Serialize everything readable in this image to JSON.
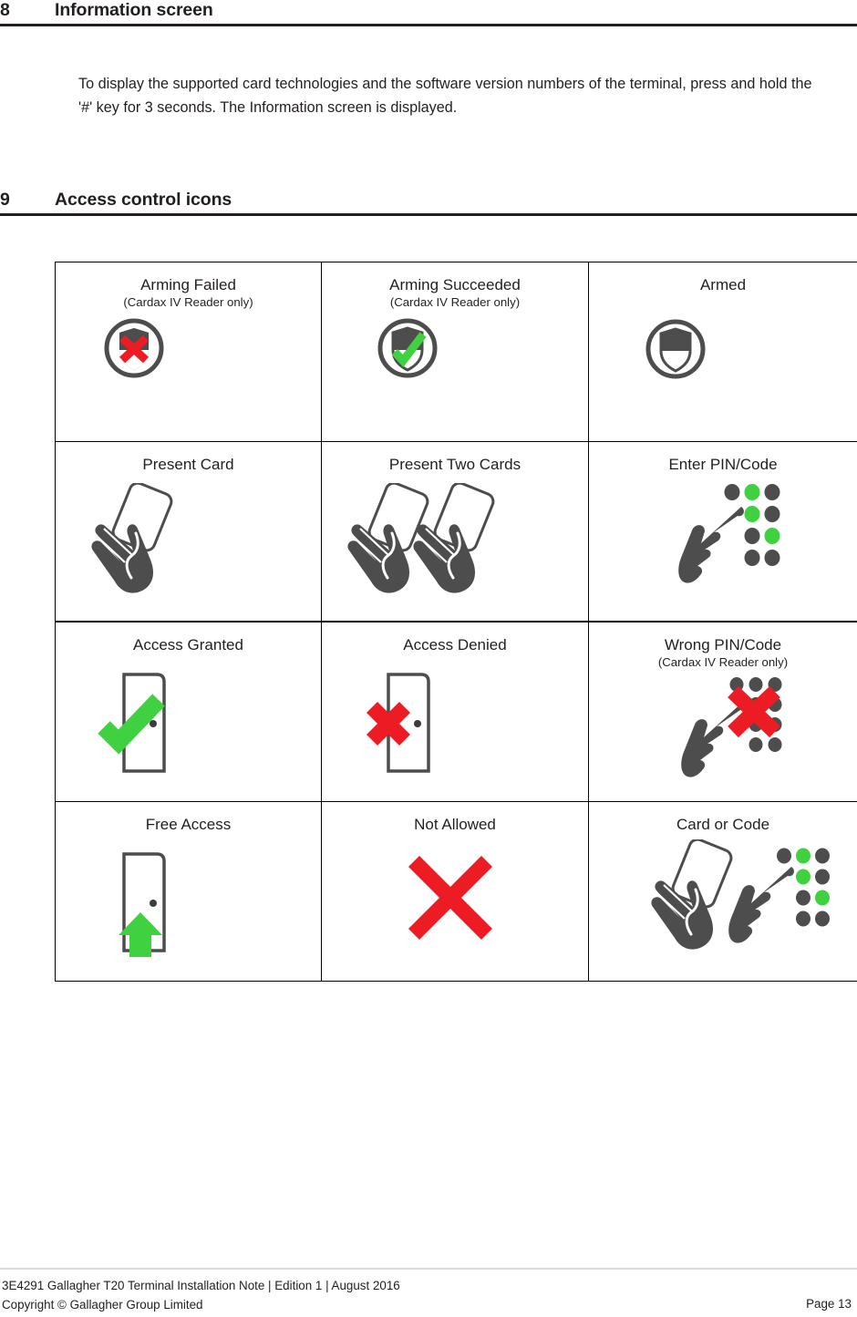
{
  "sections": [
    {
      "number": "8",
      "title": "Information screen"
    },
    {
      "number": "9",
      "title": "Access control icons"
    }
  ],
  "intro_paragraph": "To display the supported card technologies and the software version numbers of the terminal, press and hold the '#' key for 3 seconds.  The Information screen is displayed.",
  "icon_table": {
    "rows": [
      [
        {
          "label": "Arming Failed",
          "sublabel": "(Cardax IV Reader only)",
          "icon": "shield-cross-failed-icon"
        },
        {
          "label": "Arming Succeeded",
          "sublabel": "(Cardax IV Reader only)",
          "icon": "shield-tick-succeeded-icon"
        },
        {
          "label": "Armed",
          "sublabel": "",
          "icon": "shield-armed-icon"
        }
      ],
      [
        {
          "label": "Present Card",
          "sublabel": "",
          "icon": "hand-card-icon"
        },
        {
          "label": "Present Two Cards",
          "sublabel": "",
          "icon": "hand-two-cards-icon"
        },
        {
          "label": "Enter PIN/Code",
          "sublabel": "",
          "icon": "hand-keypad-icon"
        }
      ],
      [
        {
          "label": "Access Granted",
          "sublabel": "",
          "icon": "door-tick-icon"
        },
        {
          "label": "Access Denied",
          "sublabel": "",
          "icon": "door-cross-icon"
        },
        {
          "label": "Wrong PIN/Code",
          "sublabel": "(Cardax IV Reader only)",
          "icon": "hand-keypad-cross-icon"
        }
      ],
      [
        {
          "label": "Free Access",
          "sublabel": "",
          "icon": "door-arrow-icon"
        },
        {
          "label": "Not Allowed",
          "sublabel": "",
          "icon": "big-cross-icon"
        },
        {
          "label": "Card or Code",
          "sublabel": "",
          "icon": "card-or-code-icon"
        }
      ]
    ]
  },
  "footer": {
    "line1": "3E4291 Gallagher T20 Terminal Installation Note | Edition 1 | August 2016",
    "line2": "Copyright © Gallagher Group Limited",
    "page": "Page 13"
  },
  "colors": {
    "ink": "#231f20",
    "icon_gray": "#4d4d4d",
    "red": "#ed1c24",
    "green": "#3fd13f",
    "rule": "#231f20",
    "footer_rule": "#d9d9d9"
  }
}
